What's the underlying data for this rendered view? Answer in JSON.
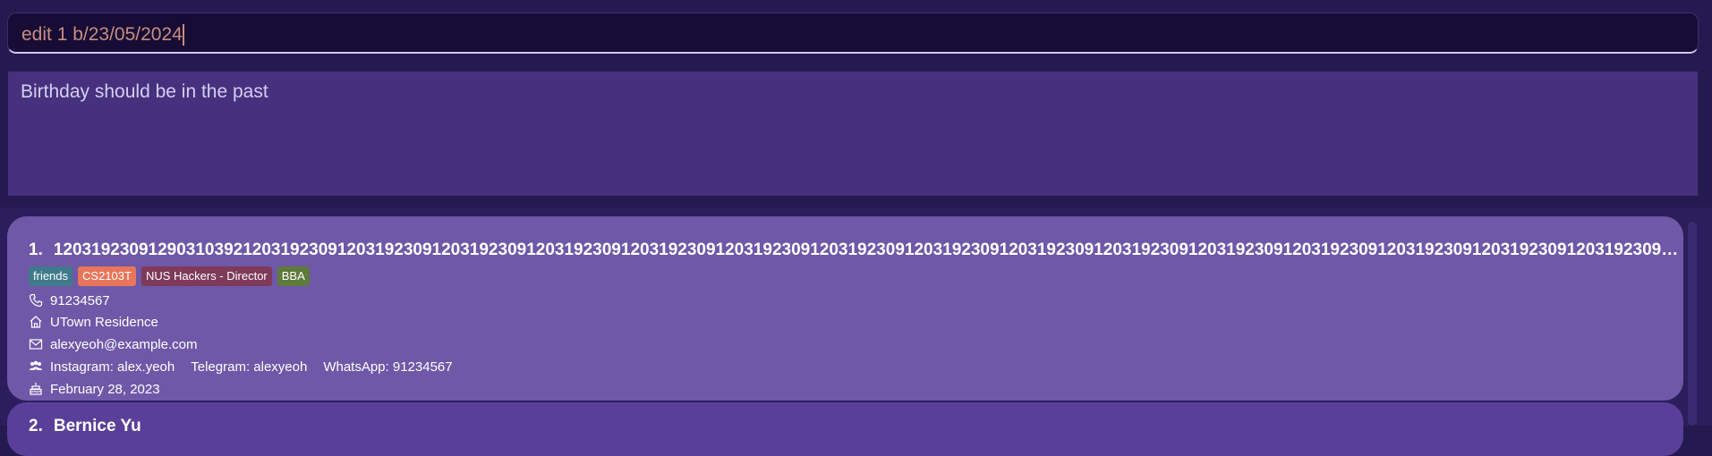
{
  "command": {
    "value": "edit 1 b/23/05/2024"
  },
  "result": {
    "message": "Birthday should be in the past"
  },
  "persons": [
    {
      "index": "1.",
      "name": "12031923091290310392120319230912031923091203192309120319230912031923091203192309120319230912031923091203192309120319230912031923091203192309120319230912031923091203192309120319230912031923091...",
      "tags": [
        {
          "label": "friends",
          "color": "#3f7a8c"
        },
        {
          "label": "CS2103T",
          "color": "#e8765a"
        },
        {
          "label": "NUS Hackers - Director",
          "color": "#7e3a58"
        },
        {
          "label": "BBA",
          "color": "#5e7a3c"
        }
      ],
      "phone": "91234567",
      "address": "UTown Residence",
      "email": "alexyeoh@example.com",
      "socials": {
        "instagram": "Instagram: alex.yeoh",
        "telegram": "Telegram: alexyeoh",
        "whatsapp": "WhatsApp: 91234567"
      },
      "birthday": "February 28, 2023"
    },
    {
      "index": "2.",
      "name": "Bernice Yu"
    }
  ],
  "colors": {
    "background": "#251a4f",
    "command_bg": "#160c36",
    "command_text": "#c98d7e",
    "result_bg": "#45317e",
    "card_bg": "#6f58a8",
    "card2_bg": "#5a3f9a"
  }
}
